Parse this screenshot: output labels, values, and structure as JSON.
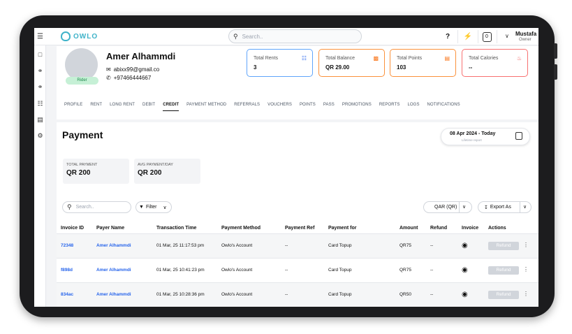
{
  "app": {
    "logo_text": "OWLO",
    "search_placeholder": "Search..",
    "help_label": "?",
    "notif_count": "0",
    "user_name": "Mustafa",
    "user_role": "Owner",
    "brand_color": "#3fb3c9"
  },
  "sidebar": {
    "icons": [
      "menu-icon",
      "map-icon",
      "bicycle-icon",
      "scooter-icon",
      "network-icon",
      "layers-icon",
      "gear-icon"
    ]
  },
  "profile": {
    "name": "Amer Alhammdi",
    "email": "abixx99@gmail.co",
    "phone": "+97466444667",
    "badge": "Rider"
  },
  "stats": [
    {
      "label": "Total Rents",
      "value": "3",
      "color": "#60a5fa"
    },
    {
      "label": "Total Balance",
      "value": "QR 29.00",
      "color": "#fb923c"
    },
    {
      "label": "Total Points",
      "value": "103",
      "color": "#fb923c"
    },
    {
      "label": "Total Calories",
      "value": "--",
      "color": "#f87171"
    }
  ],
  "tabs": [
    "PROFILE",
    "RENT",
    "LONG RENT",
    "DEBIT",
    "CREDIT",
    "PAYMENT METHOD",
    "REFERRALS",
    "VOUCHERS",
    "POINTS",
    "PASS",
    "PROMOTIONS",
    "REPORTS",
    "LOGS",
    "NOTIFICATIONS"
  ],
  "active_tab": "CREDIT",
  "payment": {
    "title": "Payment",
    "date_range": "08 Apr 2024 - Today",
    "date_sub": "Lifetime report",
    "summary": [
      {
        "label": "TOTAL PAYMENT",
        "value": "QR 200"
      },
      {
        "label": "AVG PAYMENT/DAY",
        "value": "QR 200"
      }
    ],
    "search_placeholder": "Search..",
    "filter_label": "Filter",
    "currency": "QAR (QR)",
    "export_label": "Export As"
  },
  "table": {
    "headers": [
      "Invoice ID",
      "Payer Name",
      "Transaction Time",
      "Payment Method",
      "Payment Ref",
      "Payment for",
      "Amount",
      "Refund",
      "Invoice",
      "Actions"
    ],
    "rows": [
      {
        "invoice": "72348",
        "payer": "Amer Alhammdi",
        "time": "01 Mar, 25 11:17:53 pm",
        "method": "Owlo's Account",
        "ref": "--",
        "for": "Card Topup",
        "amount": "QR75",
        "refund": "--",
        "action": "Refund"
      },
      {
        "invoice": "f898d",
        "payer": "Amer Alhammdi",
        "time": "01 Mar, 25 10:41:23 pm",
        "method": "Owlo's Account",
        "ref": "--",
        "for": "Card Topup",
        "amount": "QR75",
        "refund": "--",
        "action": "Refund"
      },
      {
        "invoice": "834ac",
        "payer": "Amer Alhammdi",
        "time": "01 Mar, 25 10:28:36 pm",
        "method": "Owlo's Account",
        "ref": "--",
        "for": "Card Topup",
        "amount": "QR50",
        "refund": "--",
        "action": "Refund"
      }
    ]
  }
}
